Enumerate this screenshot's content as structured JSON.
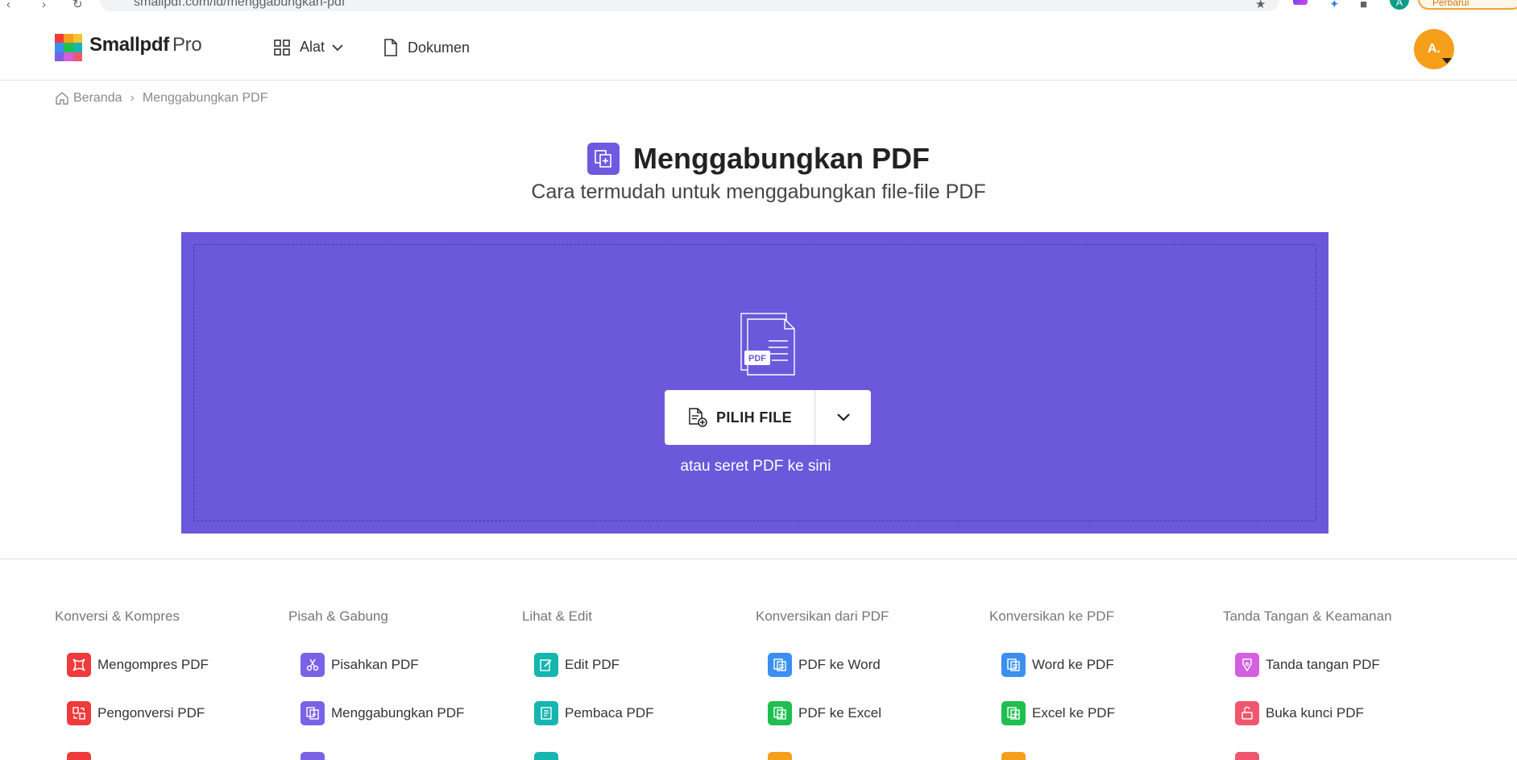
{
  "browser": {
    "url": "smallpdf.com/id/menggabungkan-pdf",
    "update_label": "Perbarui",
    "profile_initial": "A"
  },
  "nav": {
    "brand": "Smallpdf",
    "brand_suffix": "Pro",
    "tools_label": "Alat",
    "documents_label": "Dokumen",
    "avatar": "A."
  },
  "breadcrumb": {
    "home": "Beranda",
    "separator": "›",
    "current": "Menggabungkan PDF"
  },
  "hero": {
    "title": "Menggabungkan PDF",
    "subtitle": "Cara termudah untuk menggabungkan file-file PDF"
  },
  "dropzone": {
    "illustration_label": "PDF",
    "choose_label": "PILIH FILE",
    "hint": "atau seret PDF ke sini"
  },
  "colors": {
    "accent": "#6b58db",
    "avatar": "#f59f1b"
  },
  "footer": {
    "columns": [
      {
        "title": "Konversi & Kompres",
        "tools": [
          {
            "label": "Mengompres PDF",
            "color": "#ef3b3b",
            "icon": "compress-icon"
          },
          {
            "label": "Pengonversi PDF",
            "color": "#ef3b3b",
            "icon": "convert-icon"
          }
        ]
      },
      {
        "title": "Pisah & Gabung",
        "tools": [
          {
            "label": "Pisahkan PDF",
            "color": "#7b61e6",
            "icon": "scissors-icon"
          },
          {
            "label": "Menggabungkan PDF",
            "color": "#7b61e6",
            "icon": "merge-icon"
          }
        ]
      },
      {
        "title": "Lihat & Edit",
        "tools": [
          {
            "label": "Edit PDF",
            "color": "#15b5b0",
            "icon": "edit-icon"
          },
          {
            "label": "Pembaca PDF",
            "color": "#15b5b0",
            "icon": "reader-icon"
          }
        ]
      },
      {
        "title": "Konversikan dari PDF",
        "tools": [
          {
            "label": "PDF ke Word",
            "color": "#3b8ff0",
            "icon": "word-icon"
          },
          {
            "label": "PDF ke Excel",
            "color": "#1fbf4f",
            "icon": "excel-icon"
          }
        ]
      },
      {
        "title": "Konversikan ke PDF",
        "tools": [
          {
            "label": "Word ke PDF",
            "color": "#3b8ff0",
            "icon": "word-icon"
          },
          {
            "label": "Excel ke PDF",
            "color": "#1fbf4f",
            "icon": "excel-icon"
          }
        ]
      },
      {
        "title": "Tanda Tangan & Keamanan",
        "tools": [
          {
            "label": "Tanda tangan PDF",
            "color": "#d45fe0",
            "icon": "sign-icon"
          },
          {
            "label": "Buka kunci PDF",
            "color": "#f0566e",
            "icon": "unlock-icon"
          }
        ]
      }
    ]
  }
}
